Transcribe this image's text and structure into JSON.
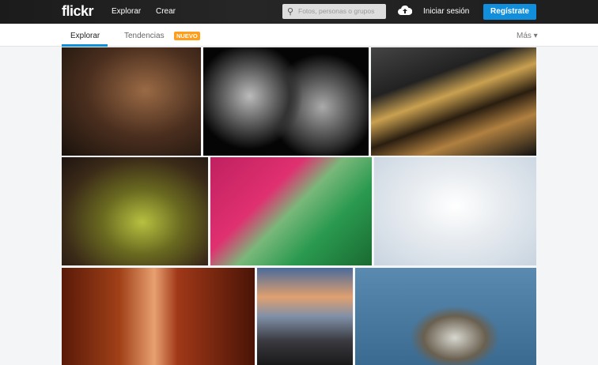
{
  "header": {
    "logo": "flickr",
    "nav": [
      "Explorar",
      "Crear"
    ],
    "search_placeholder": "Fotos, personas o grupos",
    "upload_icon": "cloud-upload-icon",
    "login": "Iniciar sesión",
    "signup": "Regístrate",
    "signup_color": "#128fdc"
  },
  "subnav": {
    "tabs": [
      {
        "label": "Explorar",
        "active": true
      },
      {
        "label": "Tendencias"
      }
    ],
    "badge": "NUEVO",
    "more": "Más ▾"
  },
  "photos": [
    "abandoned-house-sunset",
    "two-men-bw-portrait",
    "gold-ring-closeup",
    "water-drops-plants",
    "pink-green-knit-fabric",
    "white-tulle-bundle",
    "red-slot-canyon",
    "rocky-coast-sunset",
    "pintail-duck-water"
  ]
}
